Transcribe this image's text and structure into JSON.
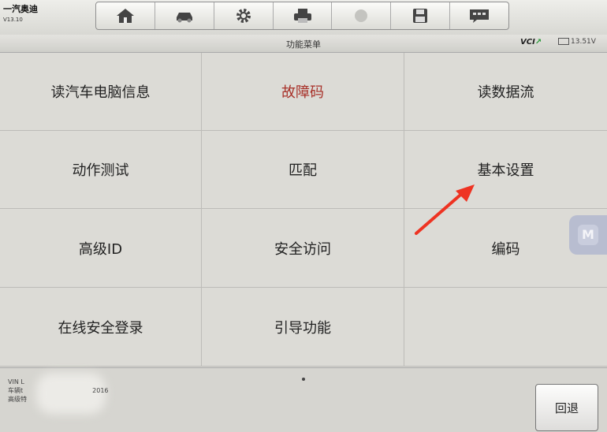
{
  "header": {
    "brand": "一汽奥迪",
    "version": "V13.10",
    "title": "功能菜单",
    "vci_label": "VCI",
    "battery": "13.51V"
  },
  "toolbar": {
    "items": [
      {
        "icon": "home-icon"
      },
      {
        "icon": "car-icon"
      },
      {
        "icon": "gear-icon"
      },
      {
        "icon": "printer-icon"
      },
      {
        "icon": "help-icon"
      },
      {
        "icon": "save-icon"
      },
      {
        "icon": "message-icon"
      }
    ]
  },
  "menu": {
    "items": [
      {
        "label": "读汽车电脑信息"
      },
      {
        "label": "故障码",
        "color": "#a8322a"
      },
      {
        "label": "读数据流"
      },
      {
        "label": "动作测试"
      },
      {
        "label": "匹配"
      },
      {
        "label": "基本设置"
      },
      {
        "label": "高级ID"
      },
      {
        "label": "安全访问"
      },
      {
        "label": "编码"
      },
      {
        "label": "在线安全登录"
      },
      {
        "label": "引导功能"
      },
      {
        "label": ""
      }
    ]
  },
  "side_button": {
    "label": "M"
  },
  "footer": {
    "vin_line": "VIN L",
    "line2": "车辆t",
    "line2_suffix": "2016",
    "line3": "高级特",
    "back_label": "回退"
  },
  "colors": {
    "highlight": "#a8322a",
    "annotation_arrow": "#ee3322"
  }
}
